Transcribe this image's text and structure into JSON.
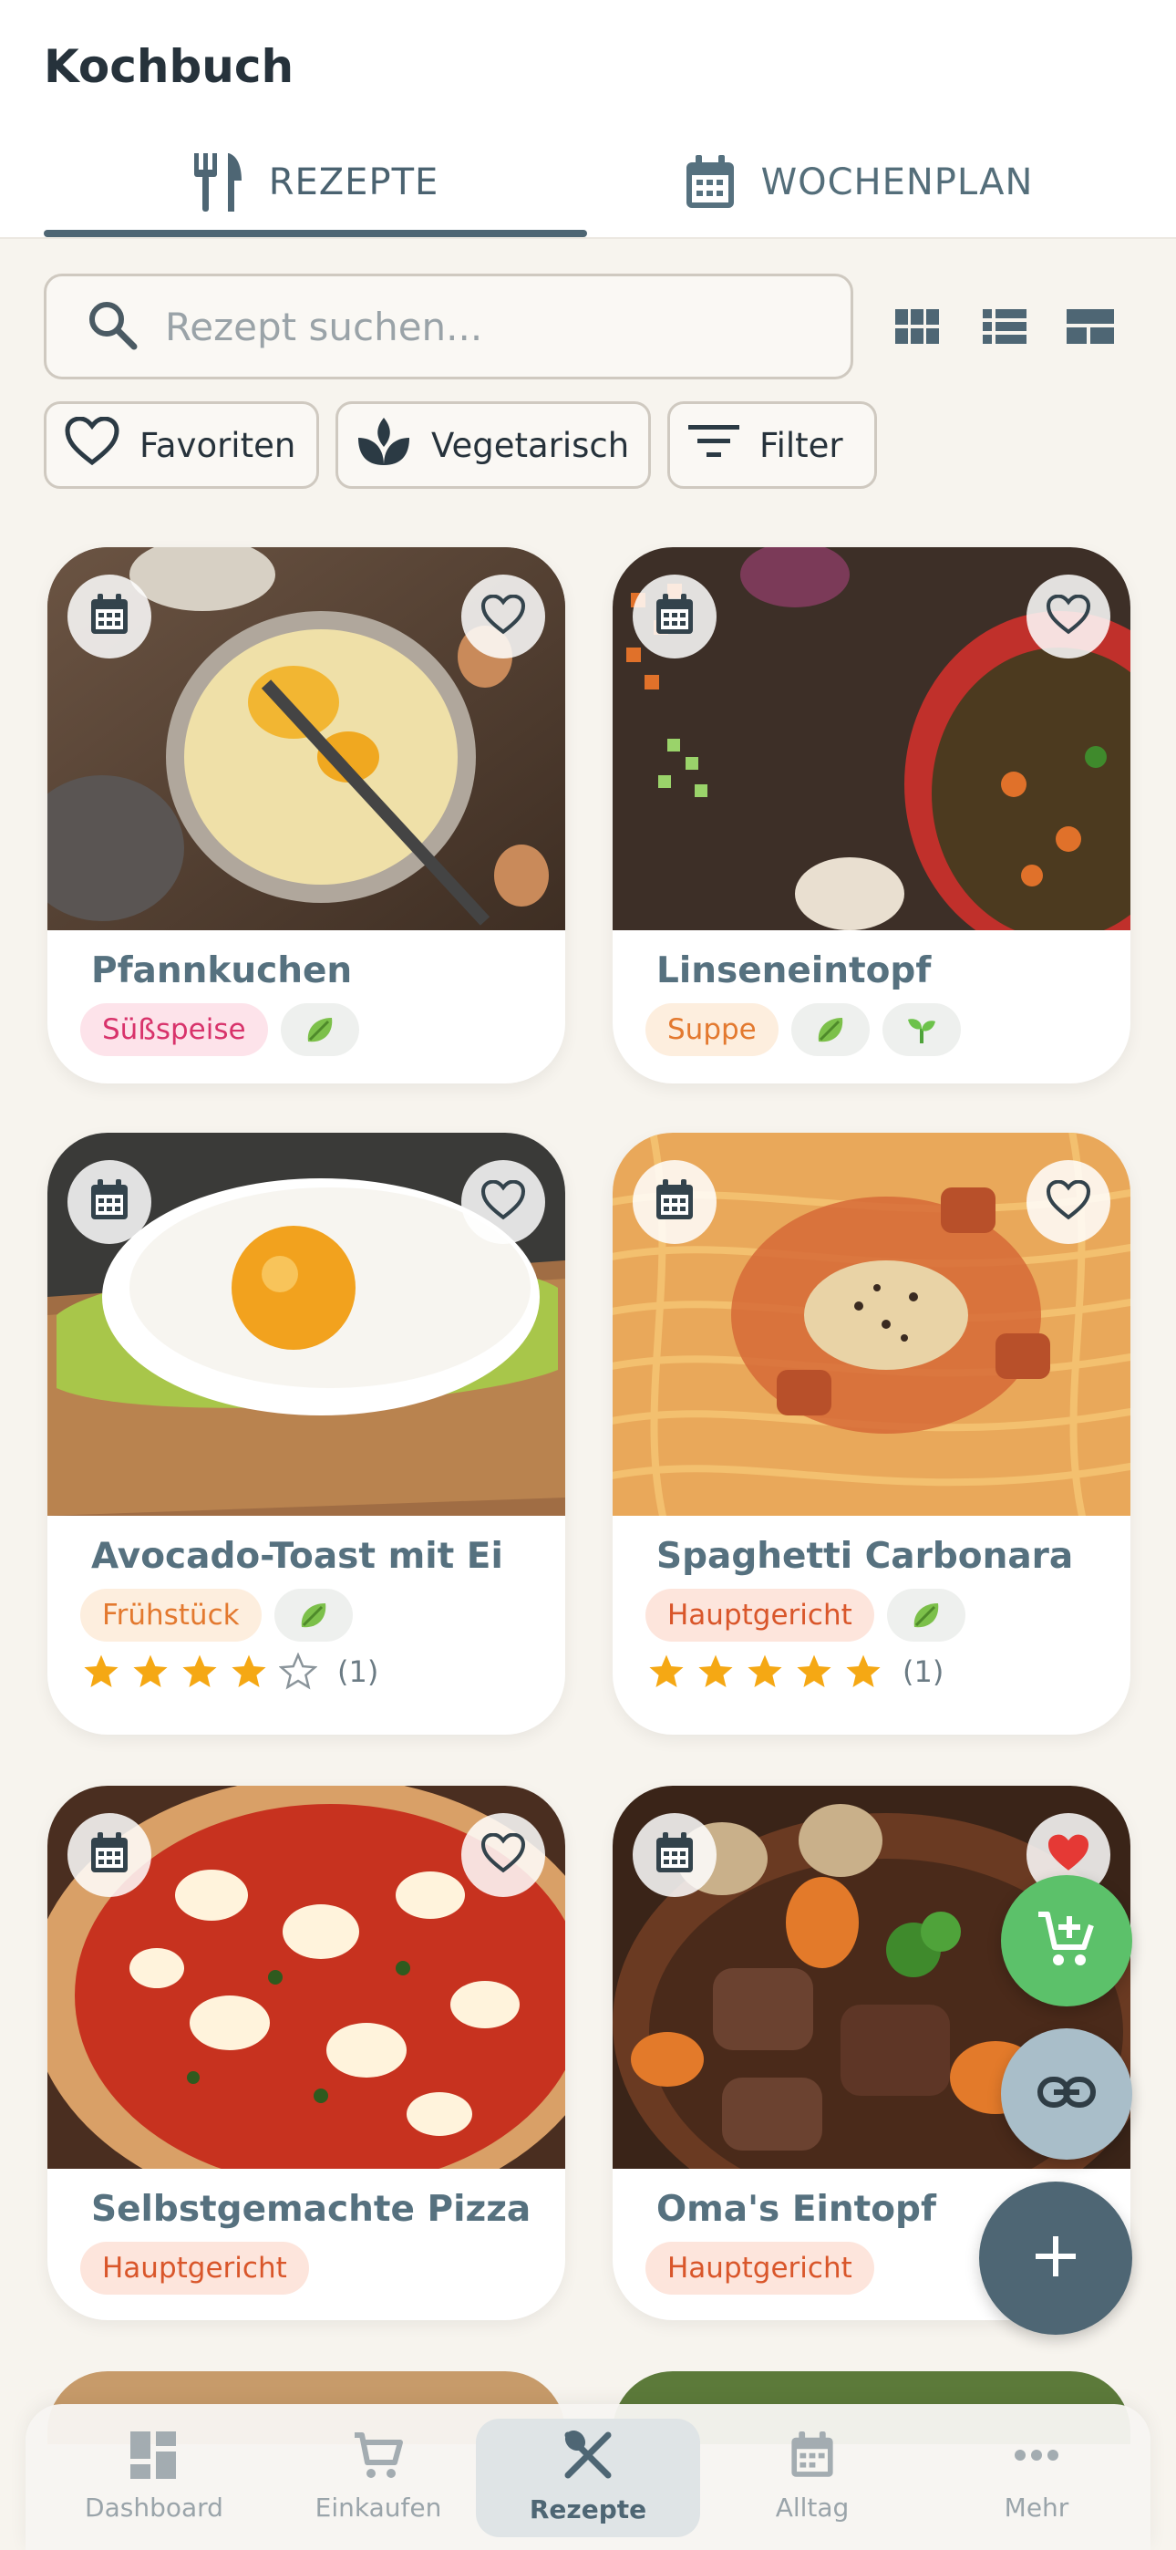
{
  "app": {
    "title": "Kochbuch"
  },
  "tabs": [
    {
      "label": "REZEPTE",
      "icon": "utensils-icon",
      "active": true
    },
    {
      "label": "WOCHENPLAN",
      "icon": "calendar-icon",
      "active": false
    }
  ],
  "search": {
    "placeholder": "Rezept suchen...",
    "value": ""
  },
  "view_modes": [
    "grid-view-icon",
    "list-view-icon",
    "compact-view-icon"
  ],
  "filters": [
    {
      "label": "Favoriten",
      "icon": "heart-outline-icon"
    },
    {
      "label": "Vegetarisch",
      "icon": "leaf-icon"
    },
    {
      "label": "Filter",
      "icon": "filter-icon"
    }
  ],
  "recipes": [
    {
      "title": "Pfannkuchen",
      "category": "Süßspeise",
      "category_color": "pink",
      "diet_icons": [
        "lettuce-icon"
      ],
      "favorite": false
    },
    {
      "title": "Linseneintopf",
      "category": "Suppe",
      "category_color": "orange",
      "diet_icons": [
        "lettuce-icon",
        "sprout-icon"
      ],
      "favorite": false
    },
    {
      "title": "Avocado-Toast mit Ei",
      "category": "Frühstück",
      "category_color": "orange",
      "diet_icons": [
        "lettuce-icon"
      ],
      "favorite": false,
      "rating": 4,
      "rating_count": "(1)"
    },
    {
      "title": "Spaghetti Carbonara",
      "category": "Hauptgericht",
      "category_color": "red",
      "diet_icons": [
        "lettuce-icon"
      ],
      "favorite": false,
      "rating": 5,
      "rating_count": "(1)"
    },
    {
      "title": "Selbstgemachte Pizza",
      "category": "Hauptgericht",
      "category_color": "red",
      "diet_icons": [],
      "favorite": false
    },
    {
      "title": "Oma's Eintopf",
      "category": "Hauptgericht",
      "category_color": "red",
      "diet_icons": [],
      "favorite": true
    }
  ],
  "fabs": [
    "add-to-cart-icon",
    "link-icon",
    "plus-icon"
  ],
  "bottom_nav": [
    {
      "label": "Dashboard",
      "icon": "dashboard-icon",
      "active": false
    },
    {
      "label": "Einkaufen",
      "icon": "cart-icon",
      "active": false
    },
    {
      "label": "Rezepte",
      "icon": "utensils-crossed-icon",
      "active": true
    },
    {
      "label": "Alltag",
      "icon": "calendar-icon",
      "active": false
    },
    {
      "label": "Mehr",
      "icon": "more-icon",
      "active": false
    }
  ],
  "colors": {
    "accent": "#4e6674",
    "background": "#f7f4ee",
    "cart_fab": "#5cc16a",
    "link_fab": "#a9bec9",
    "favorite_red": "#e53935"
  }
}
